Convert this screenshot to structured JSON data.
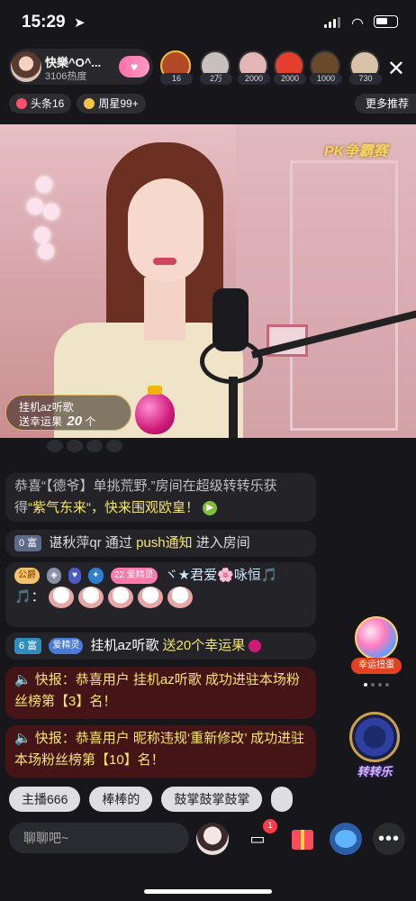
{
  "status_bar": {
    "time": "15:29",
    "location_icon": "location-arrow-icon"
  },
  "host": {
    "name": "快樂^O^...",
    "heat": "3106热度"
  },
  "viewers": [
    {
      "count": "16",
      "color": "#b24a2a"
    },
    {
      "count": "2万",
      "color": "#c7c0bd"
    },
    {
      "count": "2000",
      "color": "#e3b5b5"
    },
    {
      "count": "2000",
      "color": "#e2402c"
    },
    {
      "count": "1000",
      "color": "#6a4a2b"
    },
    {
      "count": "730",
      "color": "#d9c3a8"
    }
  ],
  "tags": {
    "headline": "头条16",
    "weekly_star": "周星99+",
    "more": "更多推荐"
  },
  "video": {
    "overlay_logo": "PK争霸赛"
  },
  "gift_popup": {
    "user": "挂机az听歌",
    "action": "送幸运果",
    "count": "20",
    "unit": "个"
  },
  "chat": {
    "system_1": {
      "prefix": "恭喜“【德爷】单挑荒野.”房间在超级转转乐获得",
      "highlight": "“紫气东来“，快来围观欧皇！"
    },
    "entry": {
      "level": "0 富",
      "user": "谌秋萍qr",
      "via": "通过",
      "source": "push通知",
      "action": "进入房间"
    },
    "fan_msg": {
      "badge_gongyuan": "公爵",
      "badge_num": "22",
      "badge_fan": "爱精灵",
      "nickname": "ヾ★君爱🌸咏恒🎵",
      "line2_prefix": "🎵："
    },
    "gift_msg": {
      "level": "6 富",
      "badge": "爱精灵",
      "user": "挂机az听歌",
      "action": "送20个幸运果"
    },
    "news_1": "快报：恭喜用户 挂机az听歌 成功进驻本场粉丝榜第【3】名！",
    "news_2": "快报：恭喜用户 昵称违规‘重新修改’ 成功进驻本场粉丝榜第【10】名！"
  },
  "widgets": {
    "lucky_egg": "幸运扭蛋",
    "wheel": "转转乐"
  },
  "quick_replies": [
    "主播666",
    "棒棒的",
    "鼓掌鼓掌鼓掌"
  ],
  "bottom": {
    "input_placeholder": "聊聊吧~",
    "message_badge": "1"
  }
}
